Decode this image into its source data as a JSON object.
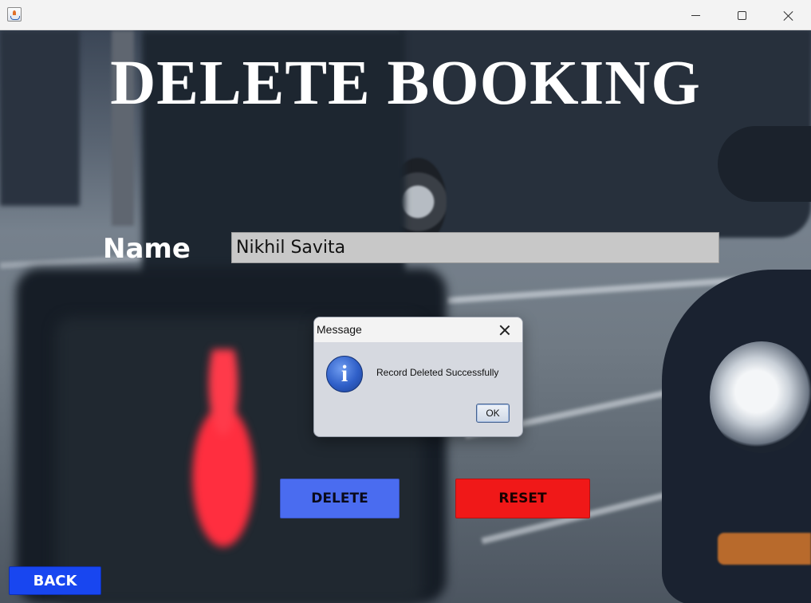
{
  "window": {
    "icon": "java-cup-icon",
    "controls": [
      "minimize-icon",
      "maximize-icon",
      "close-icon"
    ]
  },
  "form": {
    "title": "DELETE BOOKING",
    "name_label": "Name",
    "name_value": "Nikhil Savita",
    "delete_label": "DELETE",
    "reset_label": "RESET",
    "back_label": "BACK"
  },
  "dialog": {
    "title": "Message",
    "icon": "info-icon",
    "icon_glyph": "i",
    "message": "Record Deleted Successfully",
    "ok_label": "OK"
  },
  "colors": {
    "delete_button": "#4a6cf0",
    "reset_button": "#f01818",
    "back_button": "#1846f0",
    "name_field_bg": "#c8c8c8",
    "dialog_bg": "#d6d9e0"
  }
}
